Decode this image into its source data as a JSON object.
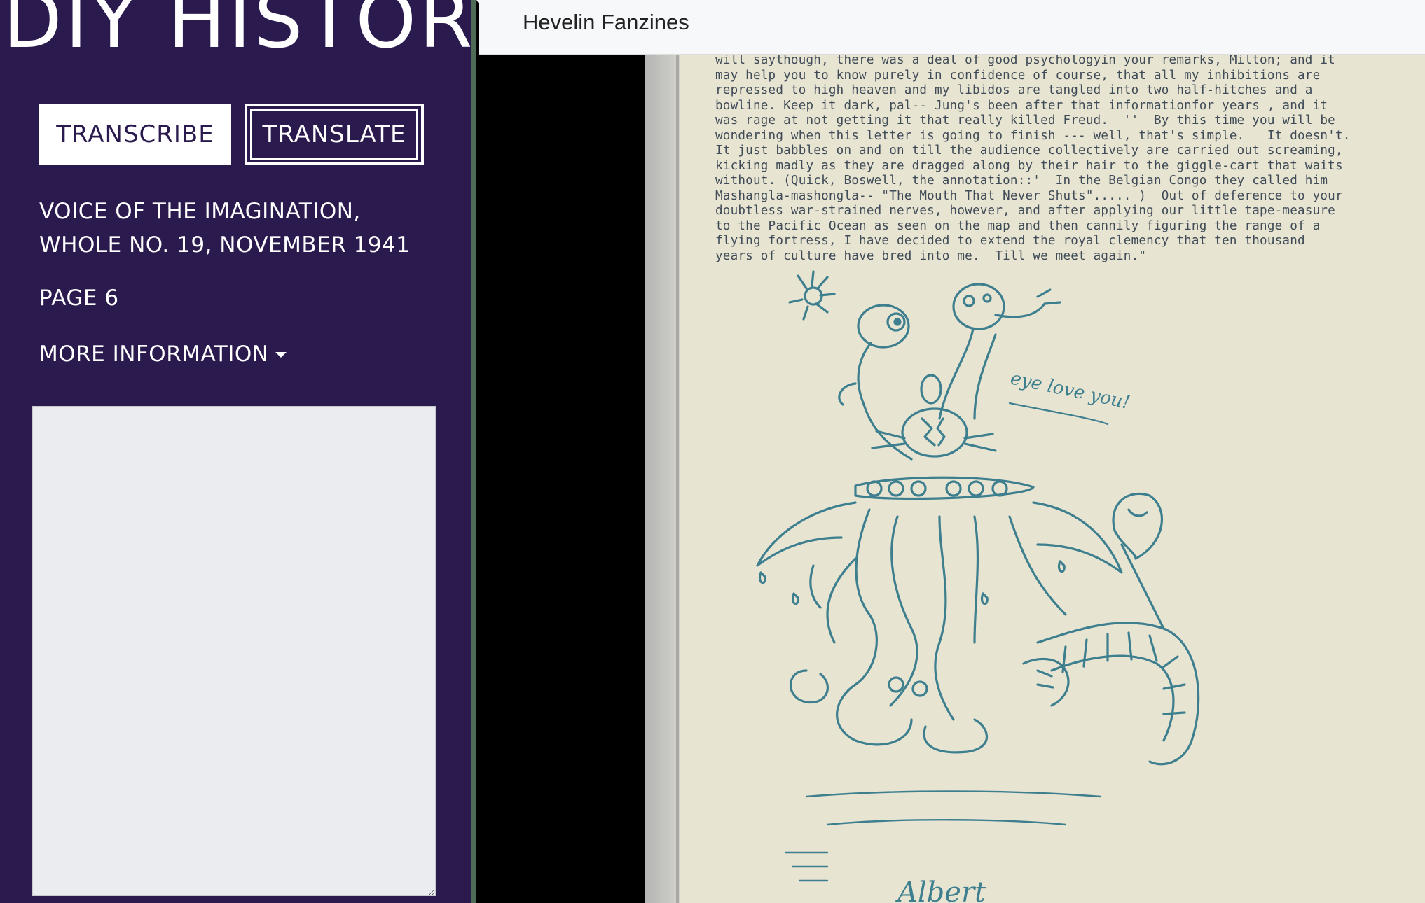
{
  "sidebar": {
    "logo": "DIY HISTORY",
    "transcribe_label": "TRANSCRIBE",
    "translate_label": "TRANSLATE",
    "document_title": "VOICE OF THE IMAGINATION, WHOLE NO. 19, NOVEMBER 1941",
    "page_label": "PAGE 6",
    "more_info_label": "MORE INFORMATION",
    "transcription_value": ""
  },
  "topbar": {
    "collection": "Hevelin Fanzines"
  },
  "document": {
    "typed_text": "will saythough, there was a deal of good psychologyin your remarks, Milton; and it\nmay help you to know purely in confidence of course, that all my inhibitions are\nrepressed to high heaven and my libidos are tangled into two half-hitches and a\nbowline. Keep it dark, pal-- Jung's been after that informationfor years , and it\nwas rage at not getting it that really killed Freud.  ''  By this time you will be\nwondering when this letter is going to finish --- well, that's simple.   It doesn't.\nIt just babbles on and on till the audience collectively are carried out screaming,\nkicking madly as they are dragged along by their hair to the giggle-cart that waits\nwithout. (Quick, Boswell, the annotation::'  In the Belgian Congo they called him\nMashangla-mashongla-- \"The Mouth That Never Shuts\"..... )  Out of deference to your\ndoubtless war-strained nerves, however, and after applying our little tape-measure\nto the Pacific Ocean as seen on the map and then cannily figuring the range of a\nflying fortress, I have decided to extend the royal clemency that ten thousand\nyears of culture have bred into me.  Till we meet again.\"",
    "drawing_caption": "eye love you!",
    "signature": "Albert"
  },
  "colors": {
    "sidebar_bg": "#2b1a4e",
    "ink": "#3d7f8f",
    "paper": "#e8e4d2"
  }
}
